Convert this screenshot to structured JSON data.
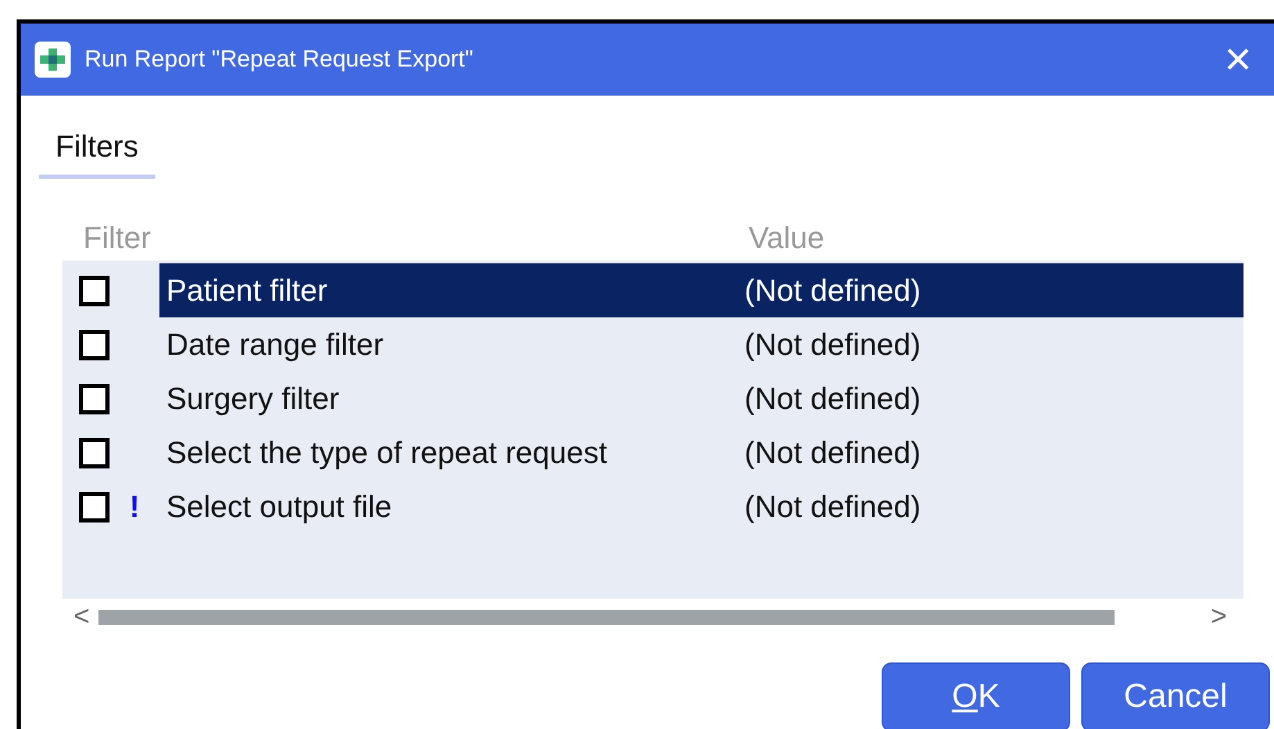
{
  "window": {
    "title": "Run Report \"Repeat Request Export\"",
    "close": "×"
  },
  "tabs": [
    {
      "label": "Filters",
      "selected": true
    }
  ],
  "table": {
    "columns": [
      "Filter",
      "Value"
    ],
    "rows": [
      {
        "checked": false,
        "filter": "Patient filter",
        "value": "(Not defined)",
        "selected": true
      },
      {
        "checked": false,
        "filter": "Date range filter",
        "value": "(Not defined)",
        "selected": false
      },
      {
        "checked": false,
        "filter": "Surgery filter",
        "value": "(Not defined)",
        "selected": false
      },
      {
        "checked": false,
        "filter": "Select the type of repeat request",
        "value": "(Not defined)",
        "selected": false
      },
      {
        "checked": false,
        "warning_mark": "!",
        "filter": "Select output file",
        "value": "(Not defined)",
        "selected": false
      }
    ]
  },
  "scrollbar": {
    "left": "<",
    "right": ">"
  },
  "buttons": [
    {
      "label": "OK",
      "underline_first": true
    },
    {
      "label": "Cancel",
      "underline_first": false
    }
  ]
}
